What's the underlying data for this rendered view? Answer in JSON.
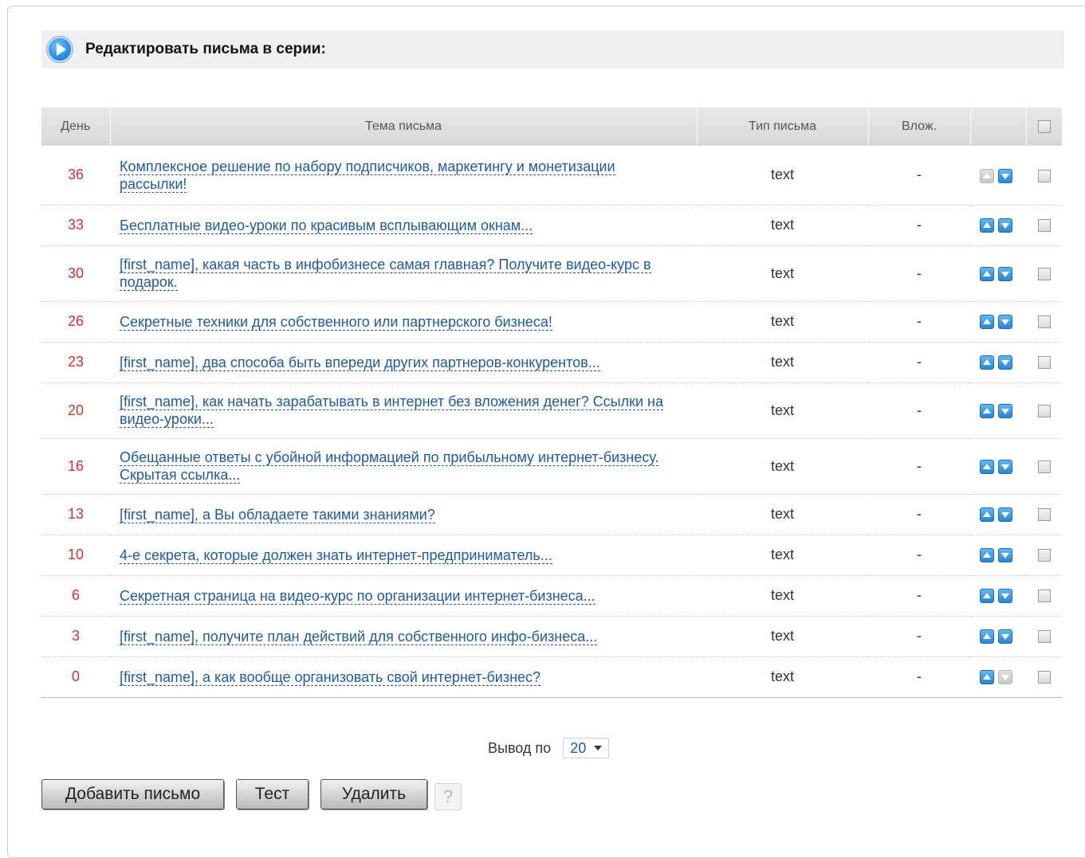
{
  "header": {
    "title": "Редактировать письма в серии:"
  },
  "table": {
    "columns": {
      "day": "День",
      "subject": "Тема письма",
      "type": "Тип письма",
      "attach": "Влож."
    },
    "rows": [
      {
        "day": "36",
        "subject": "Комплексное решение по набору подписчиков, маркетингу и монетизации рассылки!",
        "type": "text",
        "attach": "-",
        "up_enabled": false,
        "down_enabled": true
      },
      {
        "day": "33",
        "subject": "Бесплатные видео-уроки по красивым всплывающим окнам...",
        "type": "text",
        "attach": "-",
        "up_enabled": true,
        "down_enabled": true
      },
      {
        "day": "30",
        "subject": "[first_name], какая часть в инфобизнесе самая главная? Получите видео-курс в подарок.",
        "type": "text",
        "attach": "-",
        "up_enabled": true,
        "down_enabled": true
      },
      {
        "day": "26",
        "subject": "Секретные техники для собственного или партнерского бизнеса!",
        "type": "text",
        "attach": "-",
        "up_enabled": true,
        "down_enabled": true
      },
      {
        "day": "23",
        "subject": "[first_name], два способа быть впереди других партнеров-конкурентов...",
        "type": "text",
        "attach": "-",
        "up_enabled": true,
        "down_enabled": true
      },
      {
        "day": "20",
        "subject": "[first_name], как начать зарабатывать в интернет без вложения денег? Ссылки на видео-уроки...",
        "type": "text",
        "attach": "-",
        "up_enabled": true,
        "down_enabled": true
      },
      {
        "day": "16",
        "subject": "Обещанные ответы с убойной информацией по прибыльному интернет-бизнесу. Скрытая ссылка...",
        "type": "text",
        "attach": "-",
        "up_enabled": true,
        "down_enabled": true
      },
      {
        "day": "13",
        "subject": "[first_name], а Вы обладаете такими знаниями?",
        "type": "text",
        "attach": "-",
        "up_enabled": true,
        "down_enabled": true
      },
      {
        "day": "10",
        "subject": "4-е секрета, которые должен знать интернет-предприниматель...",
        "type": "text",
        "attach": "-",
        "up_enabled": true,
        "down_enabled": true
      },
      {
        "day": "6",
        "subject": "Секретная страница на видео-курс по организации интернет-бизнеса...",
        "type": "text",
        "attach": "-",
        "up_enabled": true,
        "down_enabled": true
      },
      {
        "day": "3",
        "subject": "[first_name], получите план действий для собственного инфо-бизнеса...",
        "type": "text",
        "attach": "-",
        "up_enabled": true,
        "down_enabled": true
      },
      {
        "day": "0",
        "subject": "[first_name], а как вообще организовать свой интернет-бизнес?",
        "type": "text",
        "attach": "-",
        "up_enabled": true,
        "down_enabled": false
      }
    ]
  },
  "pager": {
    "label": "Вывод по",
    "value": "20"
  },
  "buttons": {
    "add": "Добавить письмо",
    "test": "Тест",
    "delete": "Удалить",
    "help": "?"
  },
  "colors": {
    "day": "#d23131",
    "link": "#1f5a9e",
    "arrow": "#2a86d3"
  }
}
